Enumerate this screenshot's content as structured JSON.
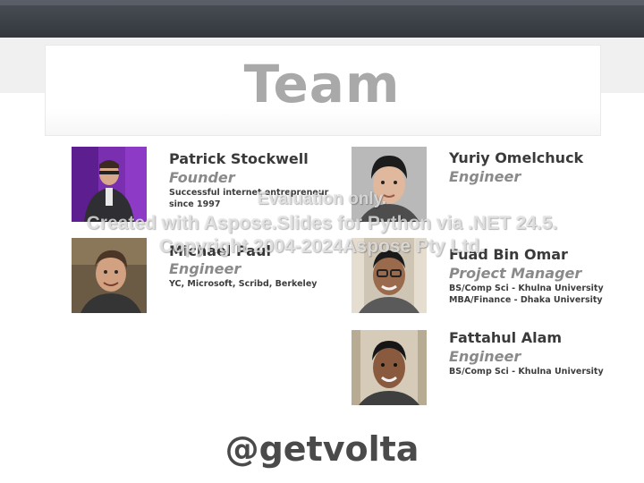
{
  "slide": {
    "title": "Team",
    "footer": "@getvolta"
  },
  "members": [
    {
      "name": "Patrick Stockwell",
      "role": "Founder",
      "details": [
        "Successful internet entrepreneur",
        "since 1997"
      ]
    },
    {
      "name": "Michael Paul",
      "role": "Engineer",
      "details": [
        "YC, Microsoft, Scribd, Berkeley"
      ]
    },
    {
      "name": "Yuriy Omelchuck",
      "role": "Engineer",
      "details": []
    },
    {
      "name": "Fuad Bin Omar",
      "role": "Project Manager",
      "details": [
        "BS/Comp Sci -  Khulna University",
        "MBA/Finance - Dhaka University"
      ]
    },
    {
      "name": "Fattahul Alam",
      "role": "Engineer",
      "details": [
        "BS/Comp Sci -  Khulna University"
      ]
    }
  ],
  "watermark": {
    "line1": "Evaluation only.",
    "line2": "Created with Aspose.Slides for Python via .NET 24.5.",
    "line3": "Copyright 2004-2024Aspose Pty Ltd."
  },
  "colors": {
    "topbar": "#3a3e45",
    "title": "#a9a9a9",
    "name": "#3a3a3a",
    "role": "#8a8a8a",
    "footer": "#4a4a4a"
  }
}
